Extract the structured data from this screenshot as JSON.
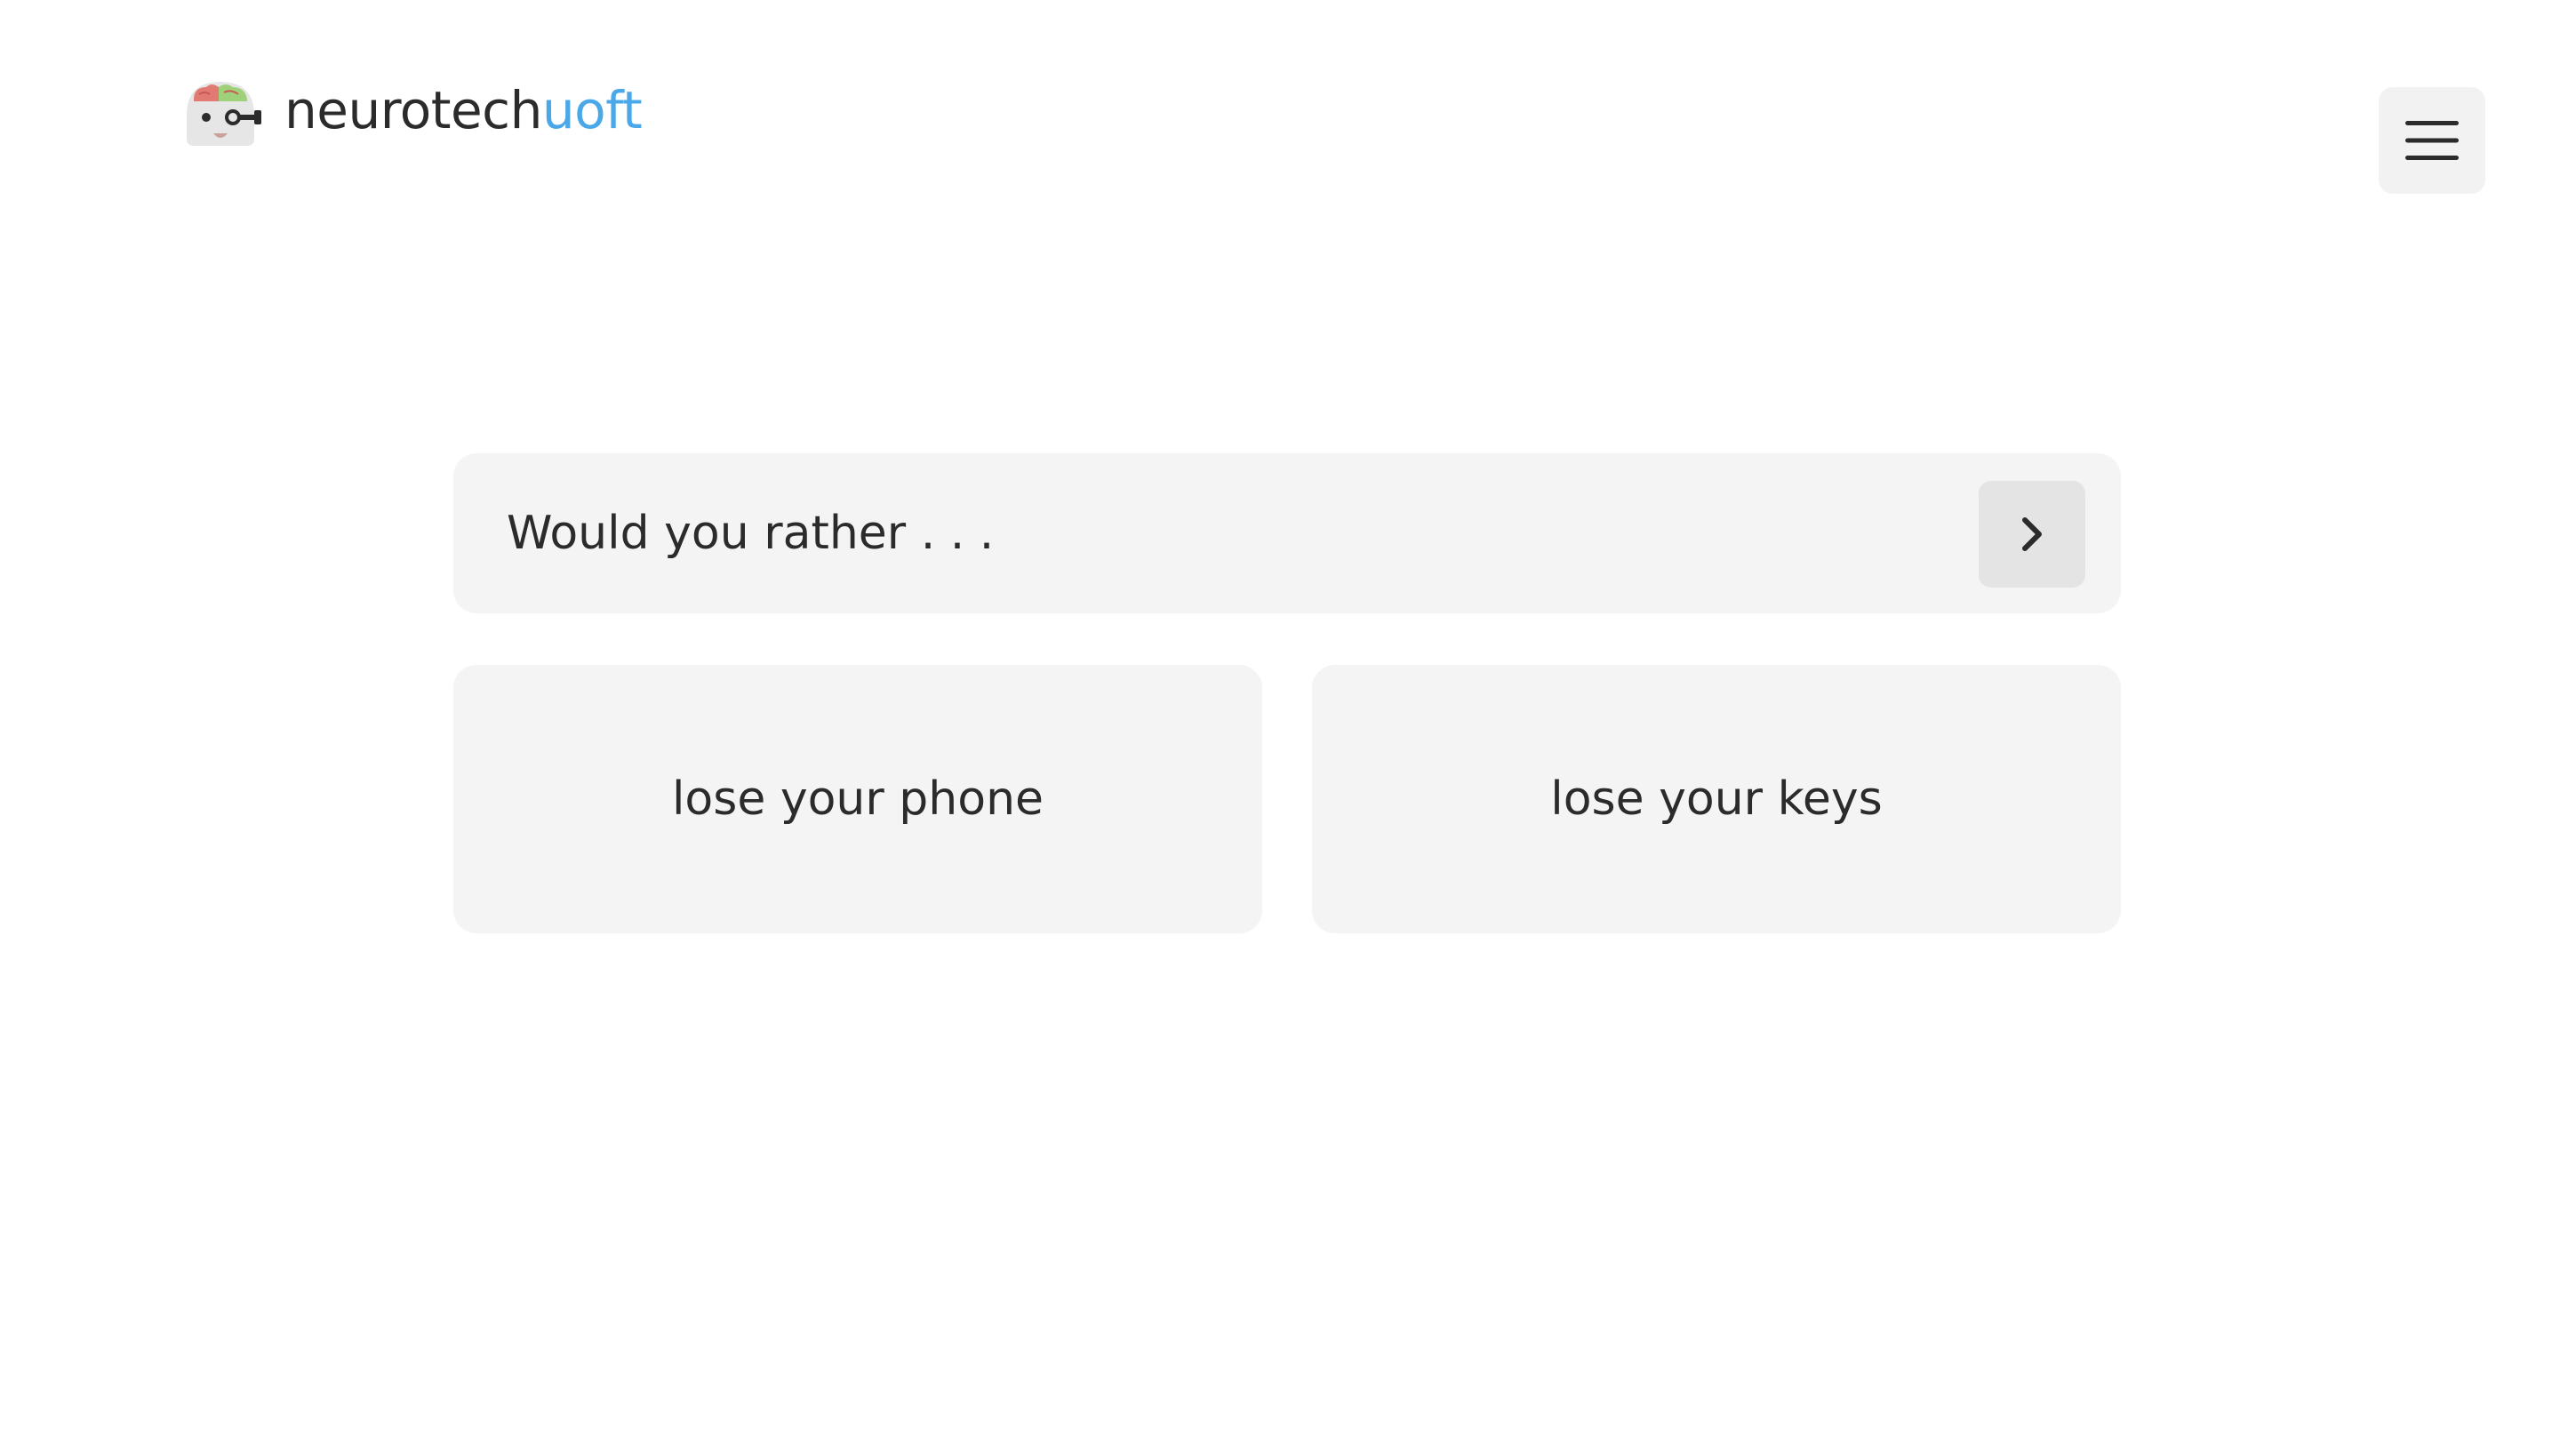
{
  "header": {
    "logo_icon": "brain-mascot-icon",
    "brand_primary": "neurotech",
    "brand_accent": "uoft",
    "menu_icon": "hamburger-menu-icon"
  },
  "question": {
    "prompt": "Would you rather . . .",
    "next_icon": "chevron-right-icon"
  },
  "options": [
    {
      "label": "lose your phone"
    },
    {
      "label": "lose your keys"
    }
  ],
  "colors": {
    "accent": "#4aa8e8",
    "text": "#2b2b2b",
    "card_background": "#f4f4f4",
    "button_background": "#e4e4e4",
    "page_background": "#ffffff"
  }
}
